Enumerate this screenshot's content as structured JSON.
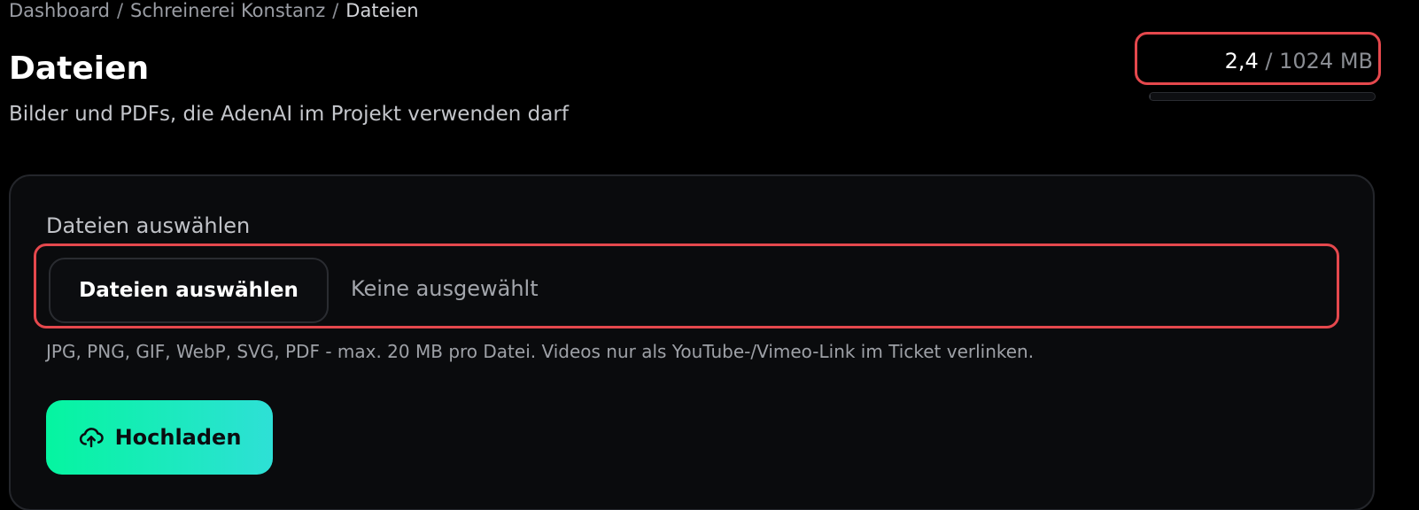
{
  "breadcrumb": {
    "items": [
      "Dashboard",
      "Schreinerei Konstanz",
      "Dateien"
    ],
    "separator": "/"
  },
  "header": {
    "title": "Dateien",
    "subtitle": "Bilder und PDFs, die AdenAI im Projekt verwenden darf"
  },
  "storage": {
    "used": "2,4",
    "separator": " / ",
    "limit": "1024 MB",
    "progress_fraction": 0.0023
  },
  "upload_form": {
    "field_label": "Dateien auswählen",
    "file_button_label": "Dateien auswählen",
    "file_status": "Keine ausgewählt",
    "help_text": "JPG, PNG, GIF, WebP, SVG, PDF - max. 20 MB pro Datei. Videos nur als YouTube-/Vimeo-Link im Ticket verlinken.",
    "submit_label": "Hochladen",
    "submit_icon": "cloud-upload-icon"
  },
  "colors": {
    "background": "#000000",
    "card": "#0a0b0d",
    "highlight_border": "#e5484d",
    "accent_start": "#05f5a0",
    "accent_end": "#2ee0d6"
  }
}
